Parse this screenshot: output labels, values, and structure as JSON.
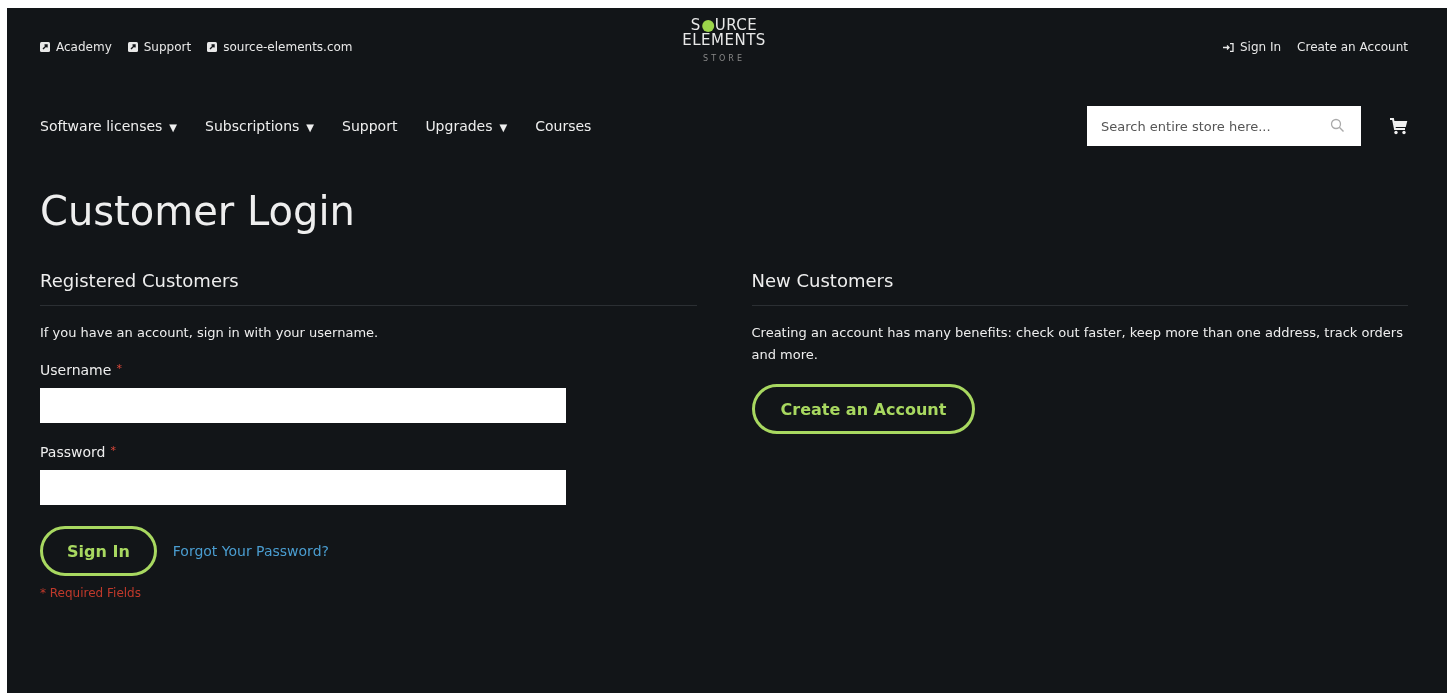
{
  "top_links": [
    {
      "label": "Academy"
    },
    {
      "label": "Support"
    },
    {
      "label": "source-elements.com"
    }
  ],
  "logo": {
    "before_dot": "S",
    "after_dot": "URCE",
    "line2": "ELEMENTS",
    "tagline": "STORE"
  },
  "account_links": [
    {
      "label": "Sign In",
      "kind": "signin"
    },
    {
      "label": "Create an Account",
      "kind": "plain"
    }
  ],
  "nav": [
    {
      "label": "Software licenses",
      "caret": "▼"
    },
    {
      "label": "Subscriptions",
      "caret": "▼"
    },
    {
      "label": "Support"
    },
    {
      "label": "Upgrades",
      "caret": "▼"
    },
    {
      "label": "Courses"
    }
  ],
  "search": {
    "placeholder": "Search entire store here..."
  },
  "page_title": "Customer Login",
  "registered": {
    "heading": "Registered Customers",
    "intro": "If you have an account, sign in with your username.",
    "fields": [
      {
        "label": "Username",
        "required_mark": "*"
      },
      {
        "label": "Password",
        "required_mark": "*"
      }
    ],
    "button": "Sign In",
    "forgot_link": "Forgot Your Password?",
    "required_note": "* Required Fields"
  },
  "new_customers": {
    "heading": "New Customers",
    "text": "Creating an account has many benefits: check out faster, keep more than one address, track orders and more.",
    "button": "Create an Account"
  }
}
